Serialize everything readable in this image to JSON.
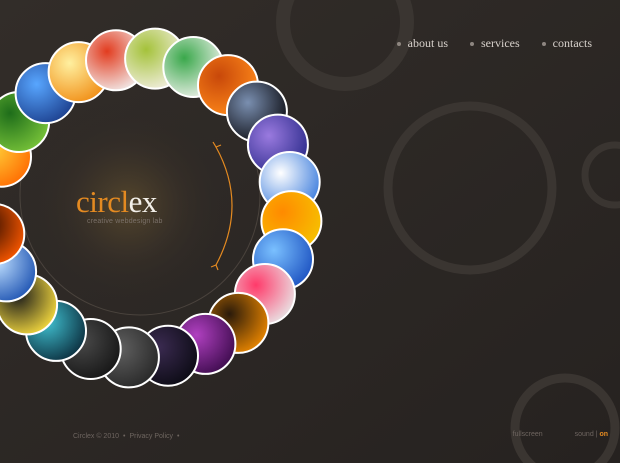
{
  "nav": [
    {
      "label": "about us"
    },
    {
      "label": "services"
    },
    {
      "label": "contacts"
    }
  ],
  "logo": {
    "part_a": "circl",
    "part_b": "ex",
    "tagline": "creative webdesign lab"
  },
  "footer": {
    "copyright": "Circlex © 2010",
    "sep": "•",
    "privacy": "Privacy Policy",
    "fullscreen": "fullscreen",
    "sound_label": "sound |",
    "sound_state": "on"
  },
  "colors": {
    "background": "#2b2724",
    "accent": "#e48a21",
    "ring_outline": "#3a3531"
  },
  "icons": {
    "rotate_arrow": "arc-arrow-icon"
  },
  "gallery_thumbnails": [
    "orange-fire-thumbnail",
    "green-bright-lights-thumbnail",
    "blue-abstract-thumbnail",
    "orange-sunburst-thumbnail",
    "colorful-dots-thumbnail",
    "green-artzone-thumbnail",
    "green-web-thumbnail",
    "orange-orb-thumbnail",
    "wire-thumbnail",
    "globe-thumbnail",
    "blue-wave-thumbnail",
    "yellow-bursts-thumbnail",
    "blend-thumbnail",
    "rainbow-stripes-thumbnail",
    "blog-thumbnail",
    "purple-swirl-thumbnail",
    "dark-ink-thumbnail",
    "grey-dark-thumbnail",
    "grey-space-thumbnail",
    "teal-sparkle-thumbnail",
    "yellow-lines-thumbnail",
    "blue-pattern-thumbnail",
    "red-fire-thumbnail"
  ]
}
